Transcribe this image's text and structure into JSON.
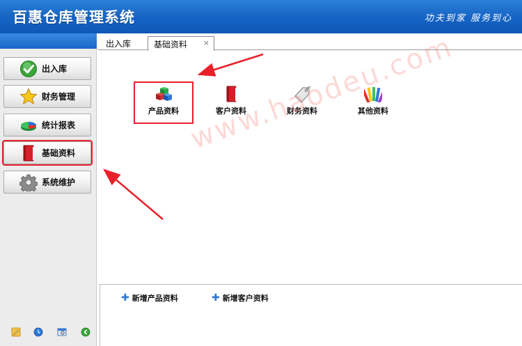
{
  "header": {
    "title": "百惠仓库管理系统",
    "slogan": "功夫到家 服务到心"
  },
  "sidebar": {
    "items": [
      {
        "label": "出入库",
        "icon": "check-icon"
      },
      {
        "label": "财务管理",
        "icon": "star-icon"
      },
      {
        "label": "统计报表",
        "icon": "pie-chart-icon"
      },
      {
        "label": "基础资料",
        "icon": "red-book-icon",
        "active": true
      },
      {
        "label": "系统维护",
        "icon": "gear-icon"
      }
    ],
    "bottom_icons": [
      "edit-icon",
      "clock-icon",
      "window-icon",
      "exit-icon"
    ]
  },
  "tabs": [
    {
      "label": "出入库"
    },
    {
      "label": "基础资料",
      "close": "×",
      "active": true
    }
  ],
  "modules": [
    {
      "label": "产品资料",
      "icon": "cubes-icon"
    },
    {
      "label": "客户资料",
      "icon": "red-book-icon"
    },
    {
      "label": "财务资料",
      "icon": "price-tag-icon"
    },
    {
      "label": "其他资料",
      "icon": "color-palette-icon"
    }
  ],
  "quick_actions": [
    {
      "plus": "✚",
      "label": "新增产品资料"
    },
    {
      "plus": "✚",
      "label": "新增客户资料"
    }
  ],
  "watermark": "www.haodeu.com",
  "colors": {
    "header_blue": "#1463c4",
    "highlight_red": "#e8202a",
    "plus_blue": "#2f78d6"
  }
}
